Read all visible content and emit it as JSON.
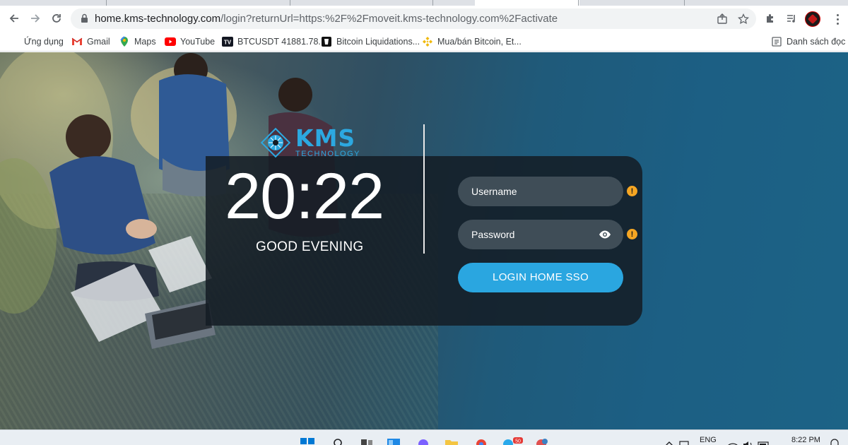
{
  "browser": {
    "url_host": "home.kms-technology.com",
    "url_path": "/login?returnUrl=https:%2F%2Fmoveit.kms-technology.com%2Factivate",
    "bookmarks": [
      {
        "label": "Ứng dụng",
        "icon": "apps-grid-icon"
      },
      {
        "label": "Gmail",
        "icon": "gmail-icon"
      },
      {
        "label": "Maps",
        "icon": "maps-icon"
      },
      {
        "label": "YouTube",
        "icon": "youtube-icon"
      },
      {
        "label": "BTCUSDT 41881.78...",
        "icon": "tradingview-icon"
      },
      {
        "label": "Bitcoin Liquidations...",
        "icon": "liquidations-icon"
      },
      {
        "label": "Mua/bán Bitcoin, Et...",
        "icon": "binance-icon"
      }
    ],
    "reading_list": "Danh sách đọc"
  },
  "login": {
    "brand_name": "KMS",
    "brand_sub": "TECHNOLOGY",
    "clock": "20:22",
    "greeting": "GOOD EVENING",
    "username_placeholder": "Username",
    "password_placeholder": "Password",
    "login_button": "LOGIN HOME SSO",
    "warning_symbol": "!"
  },
  "taskbar": {
    "language": "ENG",
    "time": "8:22 PM",
    "badge_count": "50"
  },
  "colors": {
    "accent": "#2aa6e0",
    "warning": "#f5a623",
    "card": "#141c24"
  }
}
